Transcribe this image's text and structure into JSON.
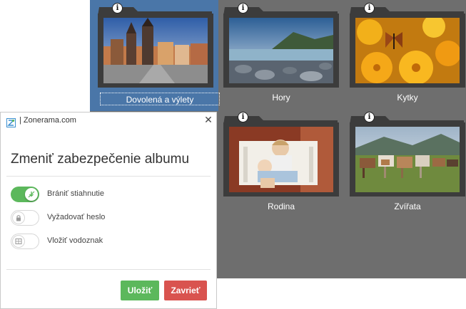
{
  "gallery": {
    "albums": [
      {
        "title": "Dovolená a výlety",
        "selected": true,
        "photo": "prague-old-town"
      },
      {
        "title": "Hory",
        "selected": false,
        "photo": "rocky-lake-shore"
      },
      {
        "title": "Kytky",
        "selected": false,
        "photo": "butterfly-on-orange-flowers"
      },
      {
        "title": "",
        "selected": false,
        "photo": "hidden"
      },
      {
        "title": "Rodina",
        "selected": false,
        "photo": "children-on-bench"
      },
      {
        "title": "Zvířata",
        "selected": false,
        "photo": "cows-in-pasture"
      }
    ],
    "info_glyph": "i"
  },
  "dialog": {
    "brand": "| Zonerama.com",
    "close_glyph": "✕",
    "title": "Zmeniť zabezpečenie albumu",
    "options": [
      {
        "label": "Brániť stiahnutie",
        "enabled": true,
        "icon": "no-download-icon"
      },
      {
        "label": "Vyžadovať heslo",
        "enabled": false,
        "icon": "lock-icon"
      },
      {
        "label": "Vložiť vodoznak",
        "enabled": false,
        "icon": "watermark-icon"
      }
    ],
    "save_label": "Uložiť",
    "cancel_label": "Zavrieť"
  },
  "colors": {
    "gallery_bg": "#6e6e6e",
    "selection": "#4a76a8",
    "toggle_on": "#5cb85c",
    "save_button": "#5cb85c",
    "cancel_button": "#d9534f"
  }
}
